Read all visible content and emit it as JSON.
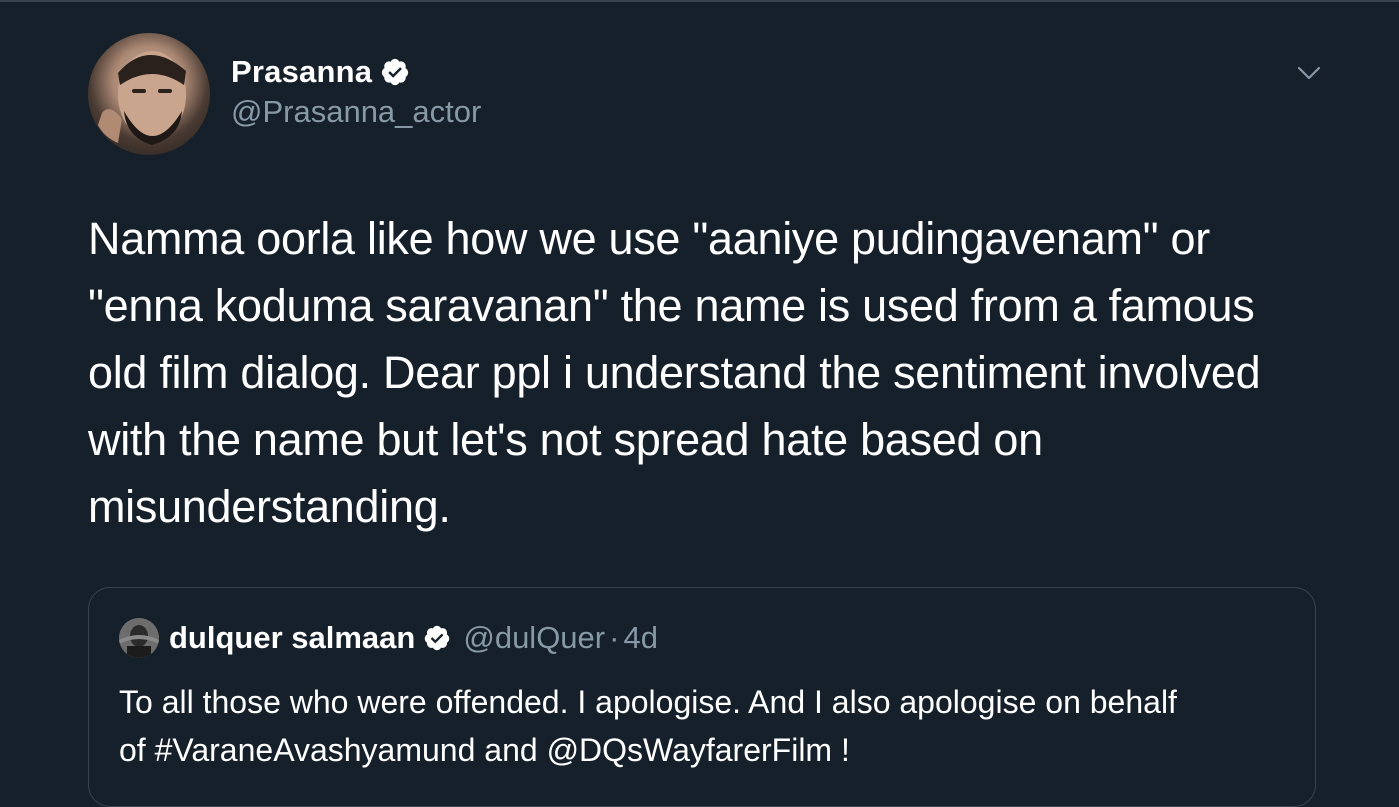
{
  "tweet": {
    "author": {
      "name": "Prasanna",
      "handle": "@Prasanna_actor",
      "verified": true
    },
    "text": "Namma oorla like how we use \"aaniye pudingavenam\" or\n\"enna koduma saravanan\" the name is used  from a famous\nold film dialog. Dear ppl i understand the sentiment involved\nwith the name but let's not spread hate based on\nmisunderstanding.",
    "menu_icon": "chevron-down-icon",
    "quoted": {
      "name": "dulquer salmaan",
      "handle": "@dulQuer",
      "separator": "·",
      "time": "4d",
      "verified": true,
      "text": "To all those who were offended. I apologise. And I also apologise on behalf\nof #VaraneAvashyamund and @DQsWayfarerFilm !"
    }
  },
  "colors": {
    "background": "#15202b",
    "text_primary": "#ffffff",
    "text_secondary": "#8899a6",
    "border": "#38444d",
    "verified_badge": "#ffffff"
  }
}
